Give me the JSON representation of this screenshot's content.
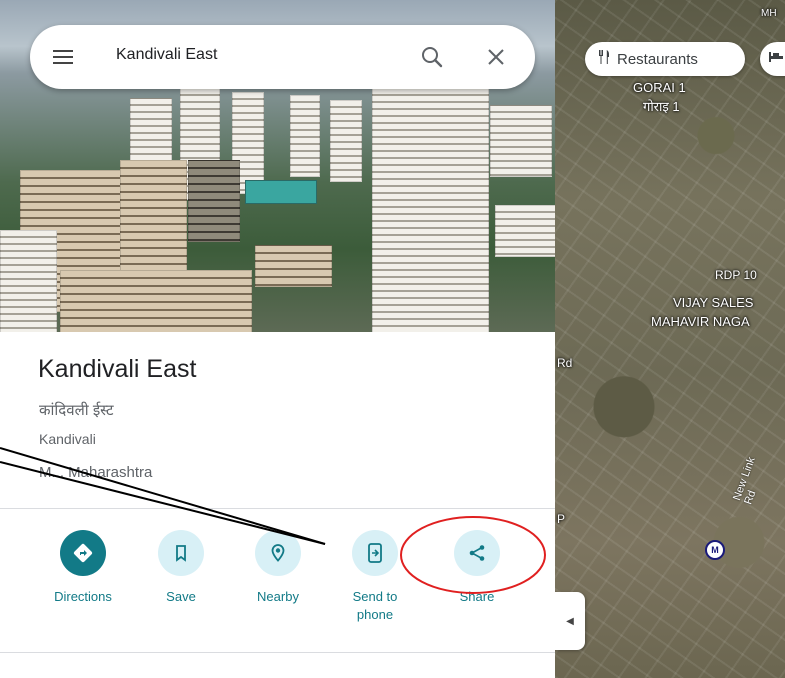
{
  "search": {
    "value": "Kandivali East"
  },
  "chips": [
    {
      "label": "Restaurants",
      "icon": "fork-knife-icon"
    },
    {
      "label": "",
      "icon": "bed-icon"
    }
  ],
  "map_labels": {
    "gorai": "GORAI 1",
    "gorai_local": "गोराइ 1",
    "rdp": "RDP 10",
    "vijay": "VIJAY SALES",
    "mahavir": "MAHAVIR NAGA",
    "rd": "Rd",
    "link_rd": "New Link Rd",
    "p": "P",
    "metro": "M",
    "mh": "MH"
  },
  "place": {
    "name": "Kandivali East",
    "local_name": "कांदिवली ईस्ट",
    "area": "Kandivali",
    "region": "M... Maharashtra"
  },
  "actions": [
    {
      "label": "Directions",
      "icon": "directions-icon"
    },
    {
      "label": "Save",
      "icon": "bookmark-icon"
    },
    {
      "label": "Nearby",
      "icon": "nearby-icon"
    },
    {
      "label": "Send to phone",
      "icon": "send-to-phone-icon"
    },
    {
      "label": "Share",
      "icon": "share-icon"
    }
  ],
  "colors": {
    "accent": "#127a87",
    "action_bg": "#d8f0f6",
    "annotation_circle": "#e02020"
  }
}
